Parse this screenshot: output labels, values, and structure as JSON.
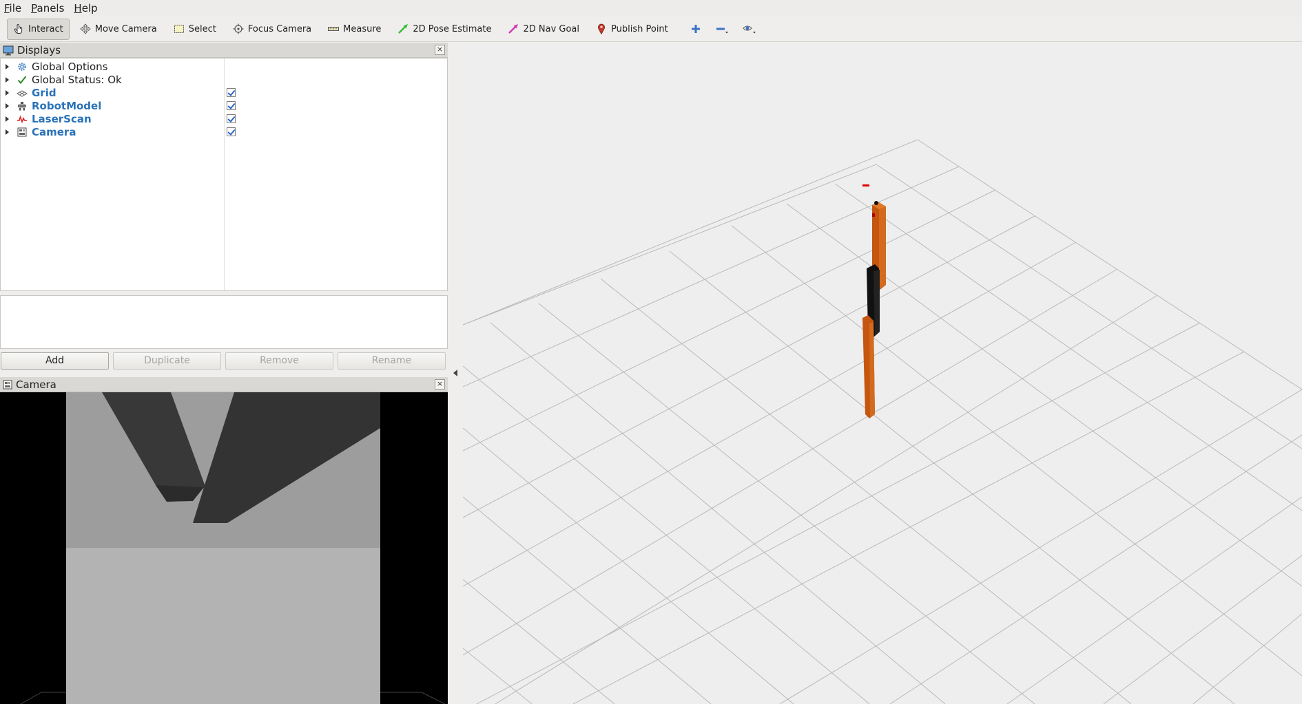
{
  "menu": {
    "items": [
      {
        "label": "File",
        "mnemonic": "F",
        "rest": "ile"
      },
      {
        "label": "Panels",
        "mnemonic": "P",
        "rest": "anels"
      },
      {
        "label": "Help",
        "mnemonic": "H",
        "rest": "elp"
      }
    ]
  },
  "toolbar": {
    "interact": "Interact",
    "move_camera": "Move Camera",
    "select": "Select",
    "focus_camera": "Focus Camera",
    "measure": "Measure",
    "pose_estimate": "2D Pose Estimate",
    "nav_goal": "2D Nav Goal",
    "publish_point": "Publish Point",
    "colors": {
      "pose_estimate": "#2fc030",
      "nav_goal": "#d434b4",
      "publish_point": "#c33a2a",
      "add": "#3b72c6"
    }
  },
  "displays_panel": {
    "title": "Displays",
    "rows": [
      {
        "label": "Global Options",
        "icon": "gear-icon",
        "checkbox": false,
        "highlight": false
      },
      {
        "label": "Global Status: Ok",
        "icon": "checkmark-icon",
        "checkbox": false,
        "highlight": false
      },
      {
        "label": "Grid",
        "icon": "grid-icon",
        "checkbox": true,
        "highlight": true
      },
      {
        "label": "RobotModel",
        "icon": "robot-icon",
        "checkbox": true,
        "highlight": true
      },
      {
        "label": "LaserScan",
        "icon": "laser-icon",
        "checkbox": true,
        "highlight": true
      },
      {
        "label": "Camera",
        "icon": "camera-icon",
        "checkbox": true,
        "highlight": true
      }
    ],
    "buttons": {
      "add": "Add",
      "duplicate": "Duplicate",
      "remove": "Remove",
      "rename": "Rename"
    }
  },
  "camera_panel": {
    "title": "Camera"
  },
  "close_glyph": "×"
}
